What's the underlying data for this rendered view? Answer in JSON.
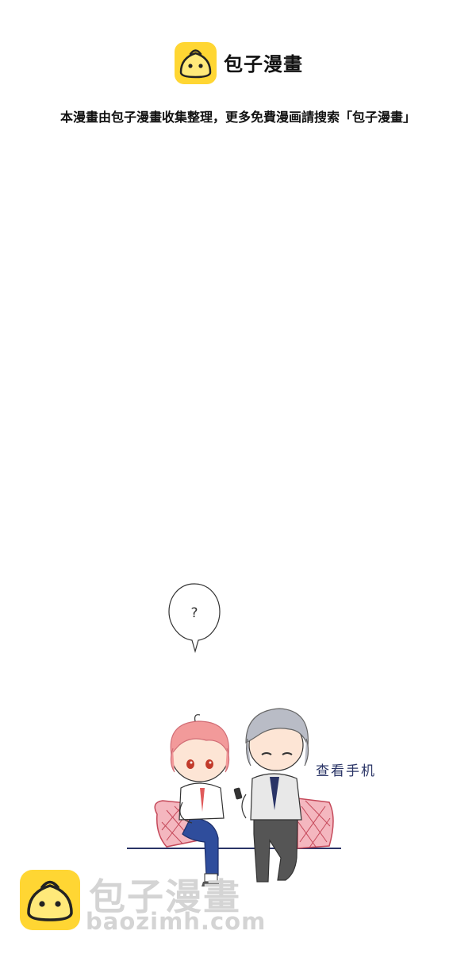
{
  "header": {
    "brand_name": "包子漫畫",
    "logo_icon": "bun-logo-icon",
    "brand_color": "#FFD633"
  },
  "notice": {
    "text": "本漫畫由包子漫畫收集整理，更多免費漫画請搜索「包子漫畫」"
  },
  "comic": {
    "bubble_text": "?",
    "caption": "查看手机"
  },
  "watermark": {
    "name": "包子漫畫",
    "url": "baozimh.com",
    "color": "#D4D4D4"
  }
}
